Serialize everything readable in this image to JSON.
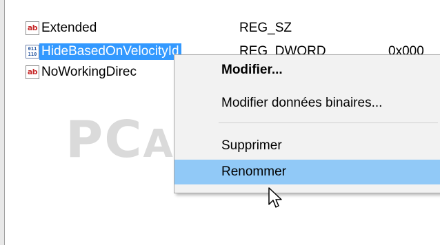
{
  "registry_values": [
    {
      "name": "Extended",
      "type": "REG_SZ",
      "data": "",
      "icon": "string-value-icon",
      "icon_text": "ab"
    },
    {
      "name": "HideBasedOnVelocityId",
      "type": "REG_DWORD",
      "data": "0x000",
      "icon": "binary-value-icon",
      "icon_text": "011\n110"
    },
    {
      "name": "NoWorkingDirec",
      "type": "",
      "data": "",
      "icon": "string-value-icon",
      "icon_text": "ab"
    }
  ],
  "context_menu": {
    "items": [
      {
        "label": "Modifier...",
        "bold": true
      },
      {
        "label": "Modifier données binaires...",
        "bold": false
      },
      {
        "label": "Supprimer",
        "bold": false
      },
      {
        "label": "Renommer",
        "bold": false,
        "hover": true
      }
    ]
  },
  "watermark": {
    "big": "PC",
    "rest": "ASTUCES"
  },
  "colors": {
    "selection": "#3399ff",
    "menu_hover": "#91c9f7",
    "ab_icon": "#c62828"
  }
}
